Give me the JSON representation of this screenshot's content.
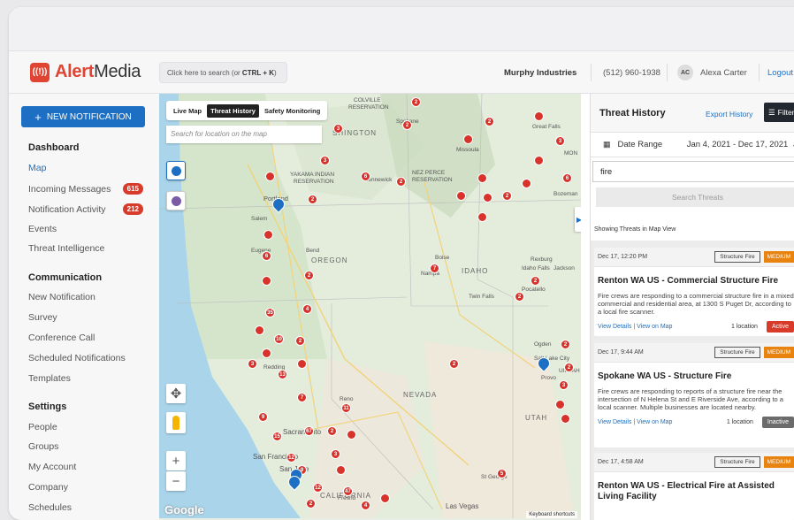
{
  "header": {
    "logo_text_red": "Alert",
    "logo_text_gray": "Media",
    "search_prefix": "Click here to search (or ",
    "search_shortcut": "CTRL + K",
    "search_suffix": ")",
    "company": "Murphy Industries",
    "phone": "(512) 960-1938",
    "avatar_initials": "AC",
    "user_name": "Alexa Carter",
    "logout": "Logout"
  },
  "sidebar": {
    "new_button": "NEW NOTIFICATION",
    "dashboard": "Dashboard",
    "map": "Map",
    "incoming": "Incoming Messages",
    "incoming_badge": "615",
    "activity": "Notification Activity",
    "activity_badge": "212",
    "events": "Events",
    "threat_intel": "Threat Intelligence",
    "communication": "Communication",
    "new_notification": "New Notification",
    "survey": "Survey",
    "conference": "Conference Call",
    "scheduled": "Scheduled Notifications",
    "templates": "Templates",
    "settings": "Settings",
    "people": "People",
    "groups": "Groups",
    "my_account": "My Account",
    "company": "Company",
    "schedules": "Schedules"
  },
  "map": {
    "tab_live": "Live Map",
    "tab_threat": "Threat History",
    "tab_safety": "Safety Monitoring",
    "search_placeholder": "Search for location on the map",
    "labels": {
      "washington": "SHINGTON",
      "oregon": "OREGON",
      "idaho": "IDAHO",
      "nevada": "NEVADA",
      "utah": "UTAH",
      "california": "CALIFORNIA",
      "portland": "Portland",
      "salem": "Salem",
      "eugene": "Eugene",
      "bend": "Bend",
      "boise": "Boise",
      "nampa": "Nampa",
      "twinfalls": "Twin Falls",
      "pocatello": "Pocatello",
      "idahofalls": "Idaho Falls",
      "rexburg": "Rexburg",
      "jackson": "Jackson",
      "spokane": "Spokane",
      "kennewick": "Kennewick",
      "missoula": "Missoula",
      "greatfalls": "Great Falls",
      "bozeman": "Bozeman",
      "redding": "Redding",
      "reno": "Reno",
      "sacramento": "Sacramento",
      "sanfrancisco": "San Francisco",
      "sanjose": "San Jose",
      "fresno": "Fresno",
      "lasvegas": "Las Vegas",
      "saltlake": "Salt Lake City",
      "provo": "Provo",
      "ogden": "Ogden",
      "stgeorge": "St George",
      "colville": "COLVILLE",
      "reservation": "RESERVATION",
      "yakama": "YAKAMA INDIAN",
      "nezperce": "NEZ PERCE",
      "mon": "MON",
      "uintah": "UINTAH"
    },
    "google": "Google",
    "keyboard": "Keyboard shortcuts"
  },
  "panel": {
    "title": "Threat History",
    "export": "Export History",
    "filters": "Filters",
    "date_label": "Date Range",
    "date_value": "Jan 4, 2021 - Dec 17, 2021",
    "query": "fire",
    "search_button": "Search Threats",
    "showing": "Showing Threats in Map View",
    "cards": [
      {
        "date": "Dec 17, 12:20 PM",
        "type": "Structure Fire",
        "severity": "MEDIUM",
        "title": "Renton WA US - Commercial Structure Fire",
        "body": "Fire crews are responding to a commercial structure fire in a mixed commercial and residential area, at 1300 S Puget Dr, according to a local fire scanner.",
        "links": "View Details | View on Map",
        "locations": "1 location",
        "status": "Active"
      },
      {
        "date": "Dec 17, 9:44 AM",
        "type": "Structure Fire",
        "severity": "MEDIUM",
        "title": "Spokane WA US - Structure Fire",
        "body": "Fire crews are responding to reports of a structure fire near the intersection of N Helena St and E Riverside Ave, according to a local scanner. Multiple businesses are located nearby.",
        "links": "View Details | View on Map",
        "locations": "1 location",
        "status": "Inactive"
      },
      {
        "date": "Dec 17, 4:58 AM",
        "type": "Structure Fire",
        "severity": "MEDIUM",
        "title": "Renton WA US - Electrical Fire at Assisted Living Facility"
      }
    ]
  },
  "colors": {
    "brand_red": "#e04433",
    "primary_blue": "#1c6fc3",
    "medium_orange": "#e8830f",
    "active_red": "#d93b2b",
    "inactive_gray": "#6b6b6b"
  }
}
